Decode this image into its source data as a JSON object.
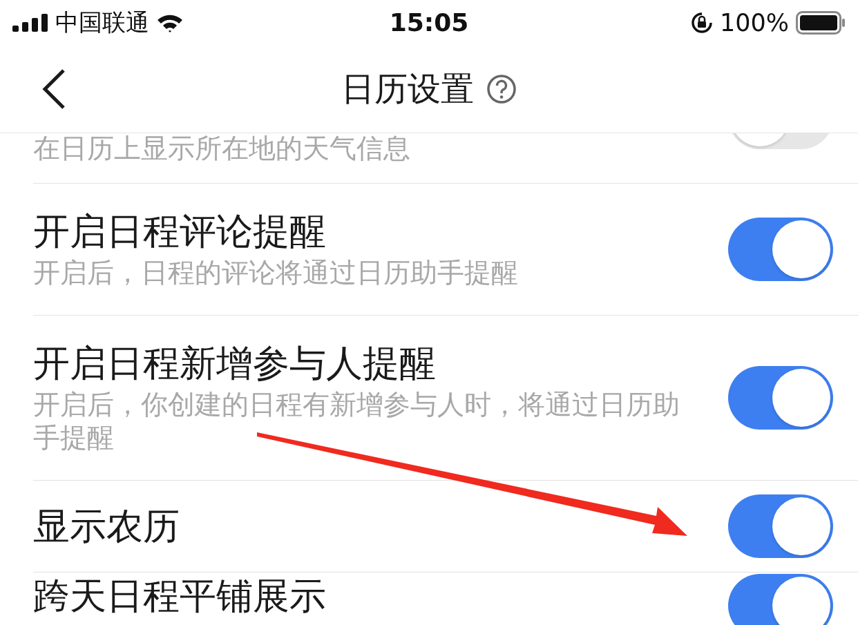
{
  "status_bar": {
    "carrier": "中国联通",
    "time": "15:05",
    "battery": "100%"
  },
  "header": {
    "title": "日历设置"
  },
  "settings": [
    {
      "kind": "partial",
      "subtitle": "在日历上显示所在地的天气信息",
      "on": false
    },
    {
      "kind": "full",
      "title": "开启日程评论提醒",
      "subtitle": "开启后，日程的评论将通过日历助手提醒",
      "on": true
    },
    {
      "kind": "full",
      "title": "开启日程新增参与人提醒",
      "subtitle": "开启后，你创建的日程有新增参与人时，将通过日历助手提醒",
      "on": true
    },
    {
      "kind": "full",
      "title": "显示农历",
      "on": true
    },
    {
      "kind": "full",
      "title": "跨天日程平铺展示",
      "on": true
    }
  ]
}
